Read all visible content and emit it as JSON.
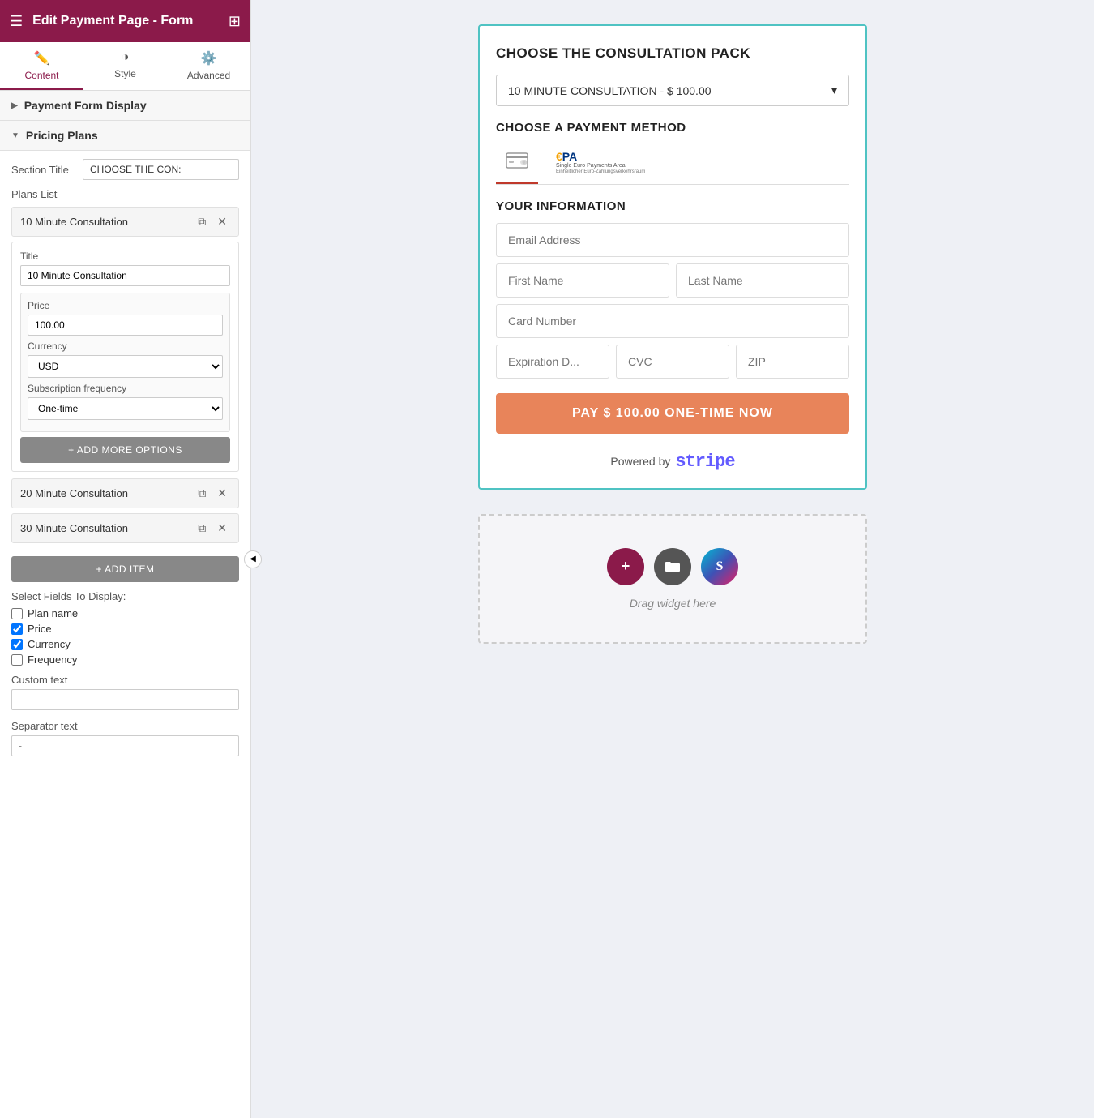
{
  "topBar": {
    "title": "Edit Payment Page - Form"
  },
  "tabs": [
    {
      "id": "content",
      "label": "Content",
      "icon": "✏️",
      "active": true
    },
    {
      "id": "style",
      "label": "Style",
      "icon": "◑",
      "active": false
    },
    {
      "id": "advanced",
      "label": "Advanced",
      "icon": "⚙️",
      "active": false
    }
  ],
  "sections": {
    "paymentFormDisplay": {
      "label": "Payment Form Display",
      "collapsed": true
    },
    "pricingPlans": {
      "label": "Pricing Plans",
      "collapsed": false
    }
  },
  "sectionTitle": {
    "label": "Section Title",
    "value": "CHOOSE THE CON:"
  },
  "plansList": {
    "label": "Plans List",
    "items": [
      {
        "id": "plan1",
        "label": "10 Minute Consultation",
        "expanded": true,
        "title": "10 Minute Consultation",
        "price": "100.00",
        "currency": "USD",
        "subscriptionFrequency": "One-time"
      },
      {
        "id": "plan2",
        "label": "20 Minute Consultation",
        "expanded": false
      },
      {
        "id": "plan3",
        "label": "30 Minute Consultation",
        "expanded": false
      }
    ]
  },
  "buttons": {
    "addMoreOptions": "+ ADD MORE OPTIONS",
    "addItem": "+ ADD ITEM"
  },
  "selectFields": {
    "label": "Select Fields To Display:",
    "fields": [
      {
        "id": "planName",
        "label": "Plan name",
        "checked": false
      },
      {
        "id": "price",
        "label": "Price",
        "checked": true
      },
      {
        "id": "currency",
        "label": "Currency",
        "checked": true
      },
      {
        "id": "frequency",
        "label": "Frequency",
        "checked": false
      }
    ]
  },
  "customText": {
    "label": "Custom text",
    "value": ""
  },
  "separatorText": {
    "label": "Separator text",
    "value": "-"
  },
  "paymentForm": {
    "mainTitle": "CHOOSE THE CONSULTATION PACK",
    "dropdownValue": "10 MINUTE CONSULTATION - $ 100.00",
    "paymentMethodTitle": "CHOOSE A PAYMENT METHOD",
    "paymentTabs": [
      {
        "id": "card",
        "label": "",
        "icon": "💳",
        "active": true
      },
      {
        "id": "sepa",
        "label": "SEPA",
        "active": false
      }
    ],
    "yourInfoTitle": "YOUR INFORMATION",
    "fields": {
      "email": "Email Address",
      "firstName": "First Name",
      "lastName": "Last Name",
      "cardNumber": "Card Number",
      "expiration": "Expiration D...",
      "cvc": "CVC",
      "zip": "ZIP"
    },
    "payButton": "PAY $ 100.00 ONE-TIME NOW",
    "poweredBy": "Powered by",
    "stripeLogo": "stripe"
  },
  "dragWidget": {
    "text": "Drag widget here"
  },
  "currencyLabel": "Currency",
  "subscriptionFrequencyLabel": "Subscription frequency"
}
